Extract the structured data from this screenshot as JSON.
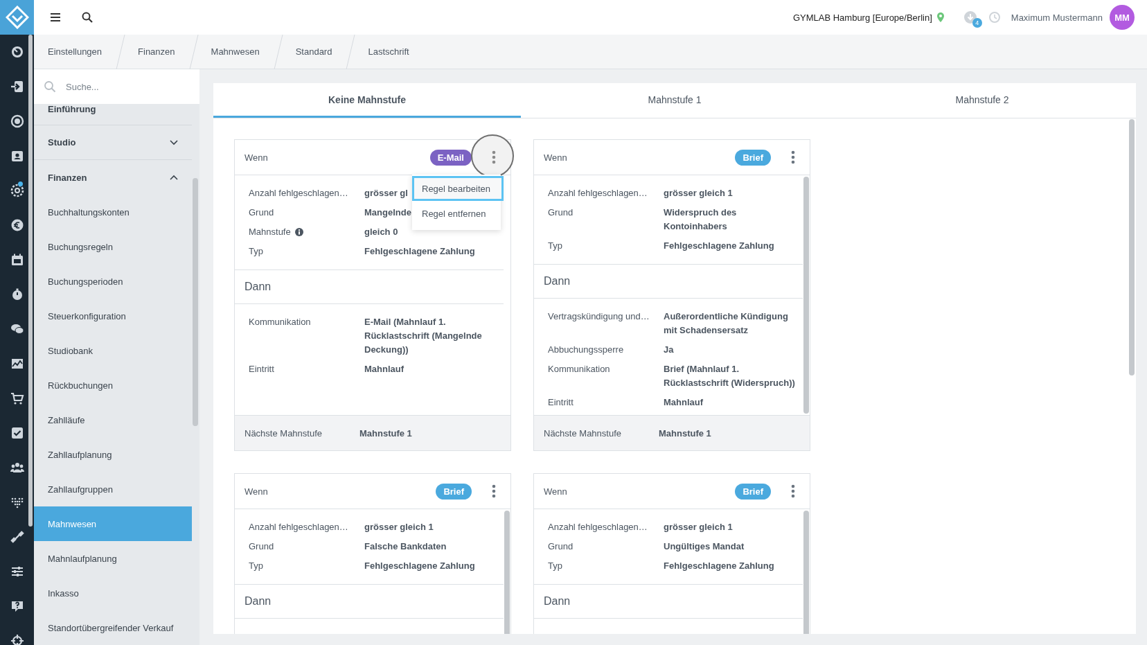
{
  "rail_items": [
    {
      "notification": false
    },
    {
      "notification": false
    },
    {
      "notification": false
    },
    {
      "notification": false
    },
    {
      "notification": true
    },
    {
      "notification": false
    },
    {
      "notification": false
    },
    {
      "notification": false
    },
    {
      "notification": false
    },
    {
      "notification": false
    },
    {
      "notification": false
    },
    {
      "notification": false
    },
    {
      "notification": false
    },
    {
      "notification": false
    },
    {
      "notification": false
    },
    {
      "notification": false
    },
    {
      "notification": false
    },
    {
      "notification": false
    }
  ],
  "topbar": {
    "location": "GYMLAB Hamburg [Europe/Berlin]",
    "downloads_badge": "4",
    "user": "Maximum Mustermann",
    "avatar_initials": "MM"
  },
  "breadcrumbs": [
    "Einstellungen",
    "Finanzen",
    "Mahnwesen",
    "Standard",
    "Lastschrift"
  ],
  "sidebar": {
    "search": {
      "placeholder": "Suche..."
    },
    "items": [
      {
        "label": "Einführung",
        "kind": "section",
        "expanded": false,
        "selected": false
      },
      {
        "label": "Studio",
        "kind": "section",
        "expanded": false,
        "selected": false
      },
      {
        "label": "Finanzen",
        "kind": "section",
        "expanded": true,
        "selected": false
      },
      {
        "label": "Buchhaltungskonten",
        "kind": "item",
        "selected": false
      },
      {
        "label": "Buchungsregeln",
        "kind": "item",
        "selected": false
      },
      {
        "label": "Buchungsperioden",
        "kind": "item",
        "selected": false
      },
      {
        "label": "Steuerkonfiguration",
        "kind": "item",
        "selected": false
      },
      {
        "label": "Studiobank",
        "kind": "item",
        "selected": false
      },
      {
        "label": "Rückbuchungen",
        "kind": "item",
        "selected": false
      },
      {
        "label": "Zahlläufe",
        "kind": "item",
        "selected": false
      },
      {
        "label": "Zahllaufplanung",
        "kind": "item",
        "selected": false
      },
      {
        "label": "Zahllaufgruppen",
        "kind": "item",
        "selected": false
      },
      {
        "label": "Mahnwesen",
        "kind": "item",
        "selected": true
      },
      {
        "label": "Mahnlaufplanung",
        "kind": "item",
        "selected": false
      },
      {
        "label": "Inkasso",
        "kind": "item",
        "selected": false
      },
      {
        "label": "Standortübergreifender Verkauf",
        "kind": "item",
        "selected": false
      }
    ]
  },
  "tabs": [
    {
      "label": "Keine Mahnstufe",
      "selected": true
    },
    {
      "label": "Mahnstufe 1",
      "selected": false
    },
    {
      "label": "Mahnstufe 2",
      "selected": false
    }
  ],
  "cards": [
    {
      "header": "Wenn",
      "badge": {
        "label": "E-Mail",
        "color": "#7b62c3"
      },
      "kebab_highlighted": true,
      "menu": {
        "items": [
          {
            "label": "Regel bearbeiten",
            "focused": true
          },
          {
            "label": "Regel entfernen",
            "focused": false
          }
        ]
      },
      "conditions": [
        {
          "label": "Anzahl fehlgeschlagen…",
          "value": "grösser gl",
          "info": false
        },
        {
          "label": "Grund",
          "value": "Mangelnde",
          "info": false
        },
        {
          "label": "Mahnstufe",
          "value": "gleich 0",
          "info": true
        },
        {
          "label": "Typ",
          "value": "Fehlgeschlagene Zahlung",
          "info": false
        }
      ],
      "then_title": "Dann",
      "actions": [
        {
          "label": "Kommunikation",
          "value": "E-Mail (Mahnlauf 1. Rücklastschrift (Mangelnde Deckung))"
        },
        {
          "label": "Eintritt",
          "value": "Mahnlauf"
        }
      ],
      "next": {
        "label": "Nächste Mahnstufe",
        "value": "Mahnstufe 1"
      }
    },
    {
      "header": "Wenn",
      "badge": {
        "label": "Brief",
        "color": "#4aa9de"
      },
      "kebab_highlighted": false,
      "scrollable": true,
      "conditions": [
        {
          "label": "Anzahl fehlgeschlagen…",
          "value": "grösser gleich 1",
          "info": false
        },
        {
          "label": "Grund",
          "value": "Widerspruch des Kontoinhabers",
          "info": false
        },
        {
          "label": "Typ",
          "value": "Fehlgeschlagene Zahlung",
          "info": false
        }
      ],
      "then_title": "Dann",
      "actions": [
        {
          "label": "Vertragskündigung und…",
          "value": "Außerordentliche Kündigung mit Schadensersatz"
        },
        {
          "label": "Abbuchungssperre",
          "value": "Ja"
        },
        {
          "label": "Kommunikation",
          "value": "Brief (Mahnlauf 1. Rücklastschrift (Widerspruch))"
        },
        {
          "label": "Eintritt",
          "value": "Mahnlauf"
        }
      ],
      "next": {
        "label": "Nächste Mahnstufe",
        "value": "Mahnstufe 1"
      }
    },
    {
      "header": "Wenn",
      "badge": {
        "label": "Brief",
        "color": "#4aa9de"
      },
      "kebab_highlighted": false,
      "scrollable": true,
      "conditions": [
        {
          "label": "Anzahl fehlgeschlagen…",
          "value": "grösser gleich 1",
          "info": false
        },
        {
          "label": "Grund",
          "value": "Falsche Bankdaten",
          "info": false
        },
        {
          "label": "Typ",
          "value": "Fehlgeschlagene Zahlung",
          "info": false
        }
      ],
      "then_title": "Dann"
    },
    {
      "header": "Wenn",
      "badge": {
        "label": "Brief",
        "color": "#4aa9de"
      },
      "kebab_highlighted": false,
      "scrollable": true,
      "conditions": [
        {
          "label": "Anzahl fehlgeschlagen…",
          "value": "grösser gleich 1",
          "info": false
        },
        {
          "label": "Grund",
          "value": "Ungültiges Mandat",
          "info": false
        },
        {
          "label": "Typ",
          "value": "Fehlgeschlagene Zahlung",
          "info": false
        }
      ],
      "then_title": "Dann"
    }
  ]
}
